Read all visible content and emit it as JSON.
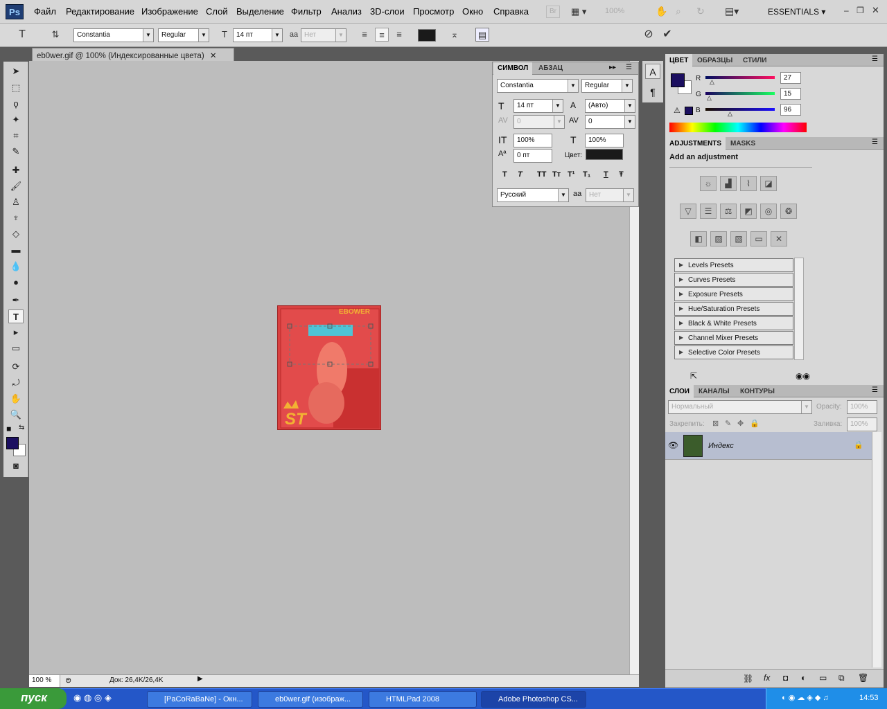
{
  "menu": [
    "Файл",
    "Редактирование",
    "Изображение",
    "Слой",
    "Выделение",
    "Фильтр",
    "Анализ",
    "3D-слои",
    "Просмотр",
    "Окно",
    "Справка"
  ],
  "app": {
    "logo": "Ps",
    "br": "Br",
    "zoom": "100%",
    "workspace": "ESSENTIALS"
  },
  "options": {
    "font_family": "Constantia",
    "font_style": "Regular",
    "font_size": "14 пт",
    "antialias": "Нет"
  },
  "doc_tab": {
    "title": "eb0wer.gif @ 100% (Индексированные цвета)"
  },
  "symbol_panel": {
    "tabs": [
      "СИМВОЛ",
      "АБЗАЦ"
    ],
    "font_family": "Constantia",
    "font_style": "Regular",
    "size": "14 пт",
    "leading": "(Авто)",
    "kerning": "0",
    "tracking": "0",
    "vscale": "100%",
    "hscale": "100%",
    "baseline": "0 пт",
    "color_label": "Цвет:",
    "language": "Русский",
    "antialias": "Нет",
    "style_buttons": [
      "T",
      "T",
      "TT",
      "Tт",
      "T¹",
      "T₁",
      "T",
      "Ŧ"
    ]
  },
  "color_panel": {
    "tabs": [
      "ЦВЕТ",
      "ОБРАЗЦЫ",
      "СТИЛИ"
    ],
    "R": "27",
    "G": "15",
    "B": "96",
    "fg": "#1b0f60"
  },
  "adjustments": {
    "tabs": [
      "ADJUSTMENTS",
      "MASKS"
    ],
    "heading": "Add an adjustment",
    "presets": [
      "Levels Presets",
      "Curves Presets",
      "Exposure Presets",
      "Hue/Saturation Presets",
      "Black & White Presets",
      "Channel Mixer Presets",
      "Selective Color Presets"
    ]
  },
  "layers": {
    "tabs": [
      "СЛОИ",
      "КАНАЛЫ",
      "КОНТУРЫ"
    ],
    "blend": "Нормальный",
    "opacity_label": "Opacity:",
    "opacity": "100%",
    "lock_label": "Закрепить:",
    "fill_label": "Заливка:",
    "fill": "100%",
    "layer_name": "Индекс"
  },
  "status": {
    "zoom": "100 %",
    "doc": "Док: 26,4K/26,4K"
  },
  "image_text": {
    "brand": "EBOWER",
    "st": "ST"
  },
  "taskbar": {
    "start": "пуск",
    "tasks": [
      "[PaCoRaBaNe] - Окн...",
      "eb0wer.gif (изображ...",
      "HTMLPad 2008",
      "Adobe Photoshop CS..."
    ],
    "time": "14:53"
  }
}
